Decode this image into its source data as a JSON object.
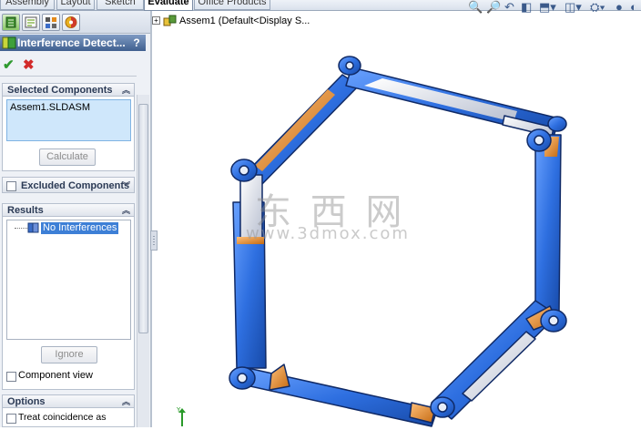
{
  "top_tabs": [
    "Assembly",
    "Layout",
    "Sketch",
    "Evaluate",
    "Office Products"
  ],
  "active_tab": "Evaluate",
  "property_manager": {
    "title": "Interference Detect...",
    "help": "?",
    "ok": "✔",
    "cancel": "✖"
  },
  "selected_components": {
    "header": "Selected Components",
    "items": [
      "Assem1.SLDASM"
    ],
    "calculate_label": "Calculate"
  },
  "excluded_components": {
    "header": "Excluded Components"
  },
  "results": {
    "header": "Results",
    "item": "No Interferences",
    "ignore_label": "Ignore",
    "component_view_label": "Component view"
  },
  "options": {
    "header": "Options",
    "treat_coincidence_label": "Treat coincidence as"
  },
  "tree": {
    "root_label": "Assem1  (Default<Display S..."
  },
  "watermark": {
    "cn": "东 西 网",
    "url": "www.3dmox.com"
  },
  "colors": {
    "tube_blue": "#2e6fe0",
    "accent_orange": "#e8902a",
    "joint_gray": "#c9ced8"
  },
  "icons": [
    "zoom-to-fit-icon",
    "zoom-area-icon",
    "previous-view-icon",
    "section-view-icon",
    "view-orientation-icon",
    "display-style-icon",
    "hide-show-icon",
    "appearance-icon",
    "scene-icon"
  ]
}
